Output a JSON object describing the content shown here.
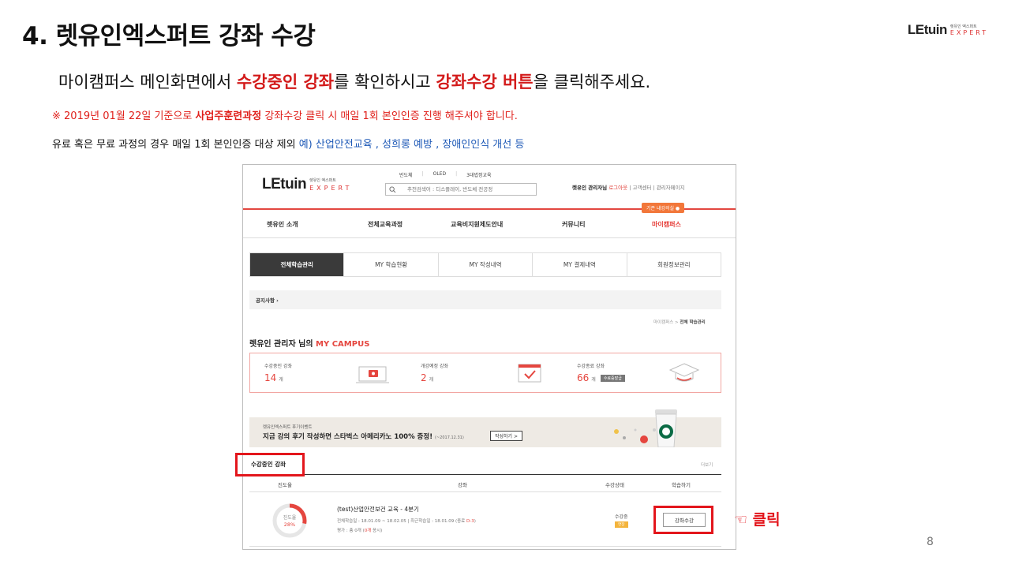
{
  "slide": {
    "title": "4. 렛유인엑스퍼트 강좌 수강",
    "brand_word": "LEtuin",
    "brand_sub_ko": "렛유인 엑스퍼트",
    "brand_sub_en": "EXPERT",
    "instruction": {
      "p1": "마이캠퍼스 메인화면에서 ",
      "h1": "수강중인 강좌",
      "p2": "를 확인하시고 ",
      "h2": "강좌수강 버튼",
      "p3": "을 클릭해주세요."
    },
    "note1": {
      "p1": "※ 2019년 01월 22일 기준으로 ",
      "b": "사업주훈련과정",
      "p2": " 강좌수강 클릭 시 매일 1회 본인인증 진행 해주셔야 합니다."
    },
    "note2": {
      "p1": "유료 혹은 무료 과정의 경우 매일 1회 본인인증 대상 제외 ",
      "blue": "예) 산업안전교육 , 성희롱 예방 , 장애인인식 개선 등"
    },
    "click_label": "☜ 클릭",
    "page_number": "8",
    "accent_color": "#e3161c"
  },
  "screenshot": {
    "logo_word": "LEtuin",
    "logo_ko": "렛유인 엑스퍼트",
    "logo_en": "EXPERT",
    "top_links": [
      "반도체",
      "OLED",
      "3대법정교육"
    ],
    "search_placeholder": "추천검색어 : 디스플레이, 반도체 전공정",
    "user_name": "렛유인 관리자님",
    "logout": "로그아웃",
    "user_links": "| 고객센터 | 관리자페이지",
    "badge": "기존 내강의실 ●",
    "nav": [
      "렛유인 소개",
      "전체교육과정",
      "교육비지원제도안내",
      "커뮤니티",
      "마이캠퍼스"
    ],
    "tabs": [
      "전체학습관리",
      "MY 학습현황",
      "MY 작성내역",
      "MY 결제내역",
      "회원정보관리"
    ],
    "notice": "공지사항 ›",
    "breadcrumb_pre": "마이캠퍼스 > ",
    "breadcrumb_cur": "전체 학습관리",
    "campus_pre": "렛유인 관리자 님의 ",
    "campus_hl": "MY CAMPUS",
    "stats": [
      {
        "label": "수강중인 강좌",
        "value": "14",
        "unit": "개"
      },
      {
        "label": "개강예정 강좌",
        "value": "2",
        "unit": "개"
      },
      {
        "label": "수강종료 강좌",
        "value": "66",
        "unit": "개",
        "pill": "수료증발급"
      }
    ],
    "banner": {
      "line1": "렛유인엑스퍼트 후기이벤트",
      "line2": "지금 강의 후기 작성하면 스타벅스 아메리카노 100% 증정!",
      "date": "(~2017.12.31)",
      "button": "작성하기 >"
    },
    "section_title": "수강중인 강좌",
    "more": "더보기",
    "table_headers": [
      "진도율",
      "강좌",
      "수강상태",
      "학습하기"
    ],
    "course": {
      "progress_label": "진도율",
      "progress_value": "28%",
      "progress": 0.28,
      "title": "(test)산업안전보건 교육 - 4분기",
      "meta1_pre": "전체학습일 : 18.01.09 ~ 18.02.05 | 최근학습일 : 18.01.09 (종료 ",
      "meta1_red": "D-3",
      "meta1_post": ")",
      "meta2_pre": "평가 : 총 0개 (",
      "meta2_red": "0개",
      "meta2_post": " 응시)",
      "status": "수강중",
      "status_tag": "연장",
      "join_button": "강좌수강"
    }
  }
}
